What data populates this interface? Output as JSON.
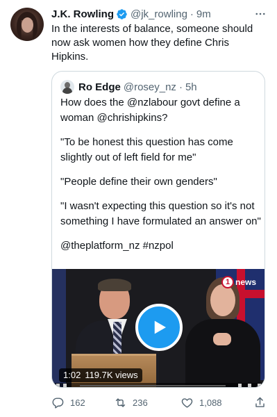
{
  "tweet": {
    "author_name": "J.K. Rowling",
    "handle": "@jk_rowling",
    "separator": "·",
    "time": "9m",
    "text": "In the interests of balance, someone should now ask women how they define Chris Hipkins."
  },
  "quote": {
    "author_name": "Ro Edge",
    "handle": "@rosey_nz",
    "separator": "·",
    "time": "5h",
    "paragraphs": [
      "How does the @nzlabour govt define a woman @chrishipkins?",
      "\"To be honest this question has come slightly out of left field for me\"",
      "\"People define their own genders\"",
      "\"I wasn't expecting this question so it's not something I have formulated an answer on\"",
      "@theplatform_nz #nzpol"
    ]
  },
  "video": {
    "duration": "1:02",
    "views": "119.7K views",
    "channel_badge": "1",
    "channel_word": "news",
    "progress_fraction": 0.0
  },
  "actions": {
    "replies": "162",
    "retweets": "236",
    "likes": "1,088"
  },
  "colors": {
    "verified_blue": "#1d9bf0",
    "play_button_blue": "#1d9bf0",
    "muted_text": "#536471",
    "border": "#cfd9de"
  },
  "icons": {
    "verified": "verified-badge-icon",
    "more": "more-horizontal-icon",
    "play": "play-icon",
    "reply": "reply-icon",
    "retweet": "retweet-icon",
    "like": "heart-icon",
    "share": "share-icon"
  }
}
